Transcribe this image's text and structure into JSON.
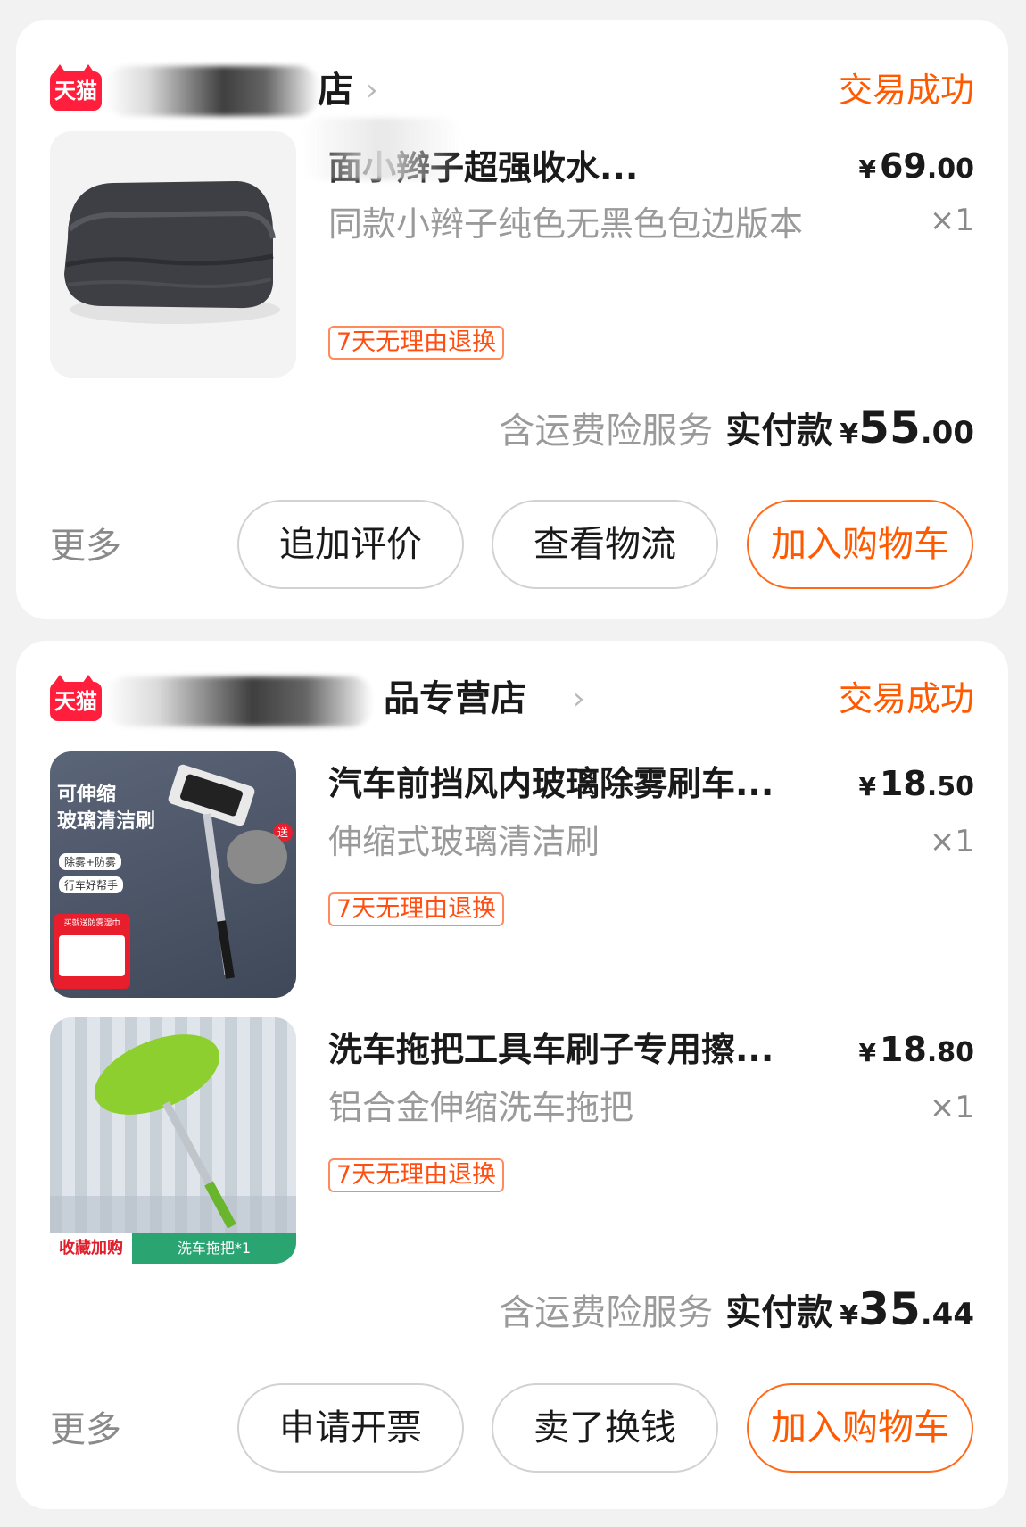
{
  "orders": [
    {
      "shop_brand": "天猫",
      "shop_name_visible": "店",
      "status": "交易成功",
      "items": [
        {
          "title": "面小辫子超强收水...",
          "sku": "同款小辫子纯色无黑色包边版本",
          "price_int": "69",
          "price_dec": ".00",
          "currency": "¥",
          "qty": "×1",
          "tag": "7天无理由退换"
        }
      ],
      "service": "含运费险服务",
      "paid_label": "实付款",
      "paid_int": "55",
      "paid_dec": ".00",
      "more": "更多",
      "buttons": [
        "追加评价",
        "查看物流",
        "加入购物车"
      ]
    },
    {
      "shop_brand": "天猫",
      "shop_name_visible": "品专营店",
      "status": "交易成功",
      "items": [
        {
          "title": "汽车前挡风内玻璃除雾刷车...",
          "sku": "伸缩式玻璃清洁刷",
          "price_int": "18",
          "price_dec": ".50",
          "currency": "¥",
          "qty": "×1",
          "tag": "7天无理由退换",
          "img_text": [
            "可伸缩",
            "玻璃清洁刷",
            "除雾+防雾",
            "行车好帮手",
            "买就送防雾湿巾",
            "送"
          ]
        },
        {
          "title": "洗车拖把工具车刷子专用擦...",
          "sku": "铝合金伸缩洗车拖把",
          "price_int": "18",
          "price_dec": ".80",
          "currency": "¥",
          "qty": "×1",
          "tag": "7天无理由退换",
          "img_text": [
            "收藏加购",
            "洗车拖把*1"
          ]
        }
      ],
      "service": "含运费险服务",
      "paid_label": "实付款",
      "paid_int": "35",
      "paid_dec": ".44",
      "more": "更多",
      "buttons": [
        "申请开票",
        "卖了换钱",
        "加入购物车"
      ]
    }
  ],
  "colors": {
    "accent": "#ff5a00",
    "tmall": "#ff1f3d",
    "muted": "#9a9a9a",
    "background": "#f2f2f2"
  }
}
